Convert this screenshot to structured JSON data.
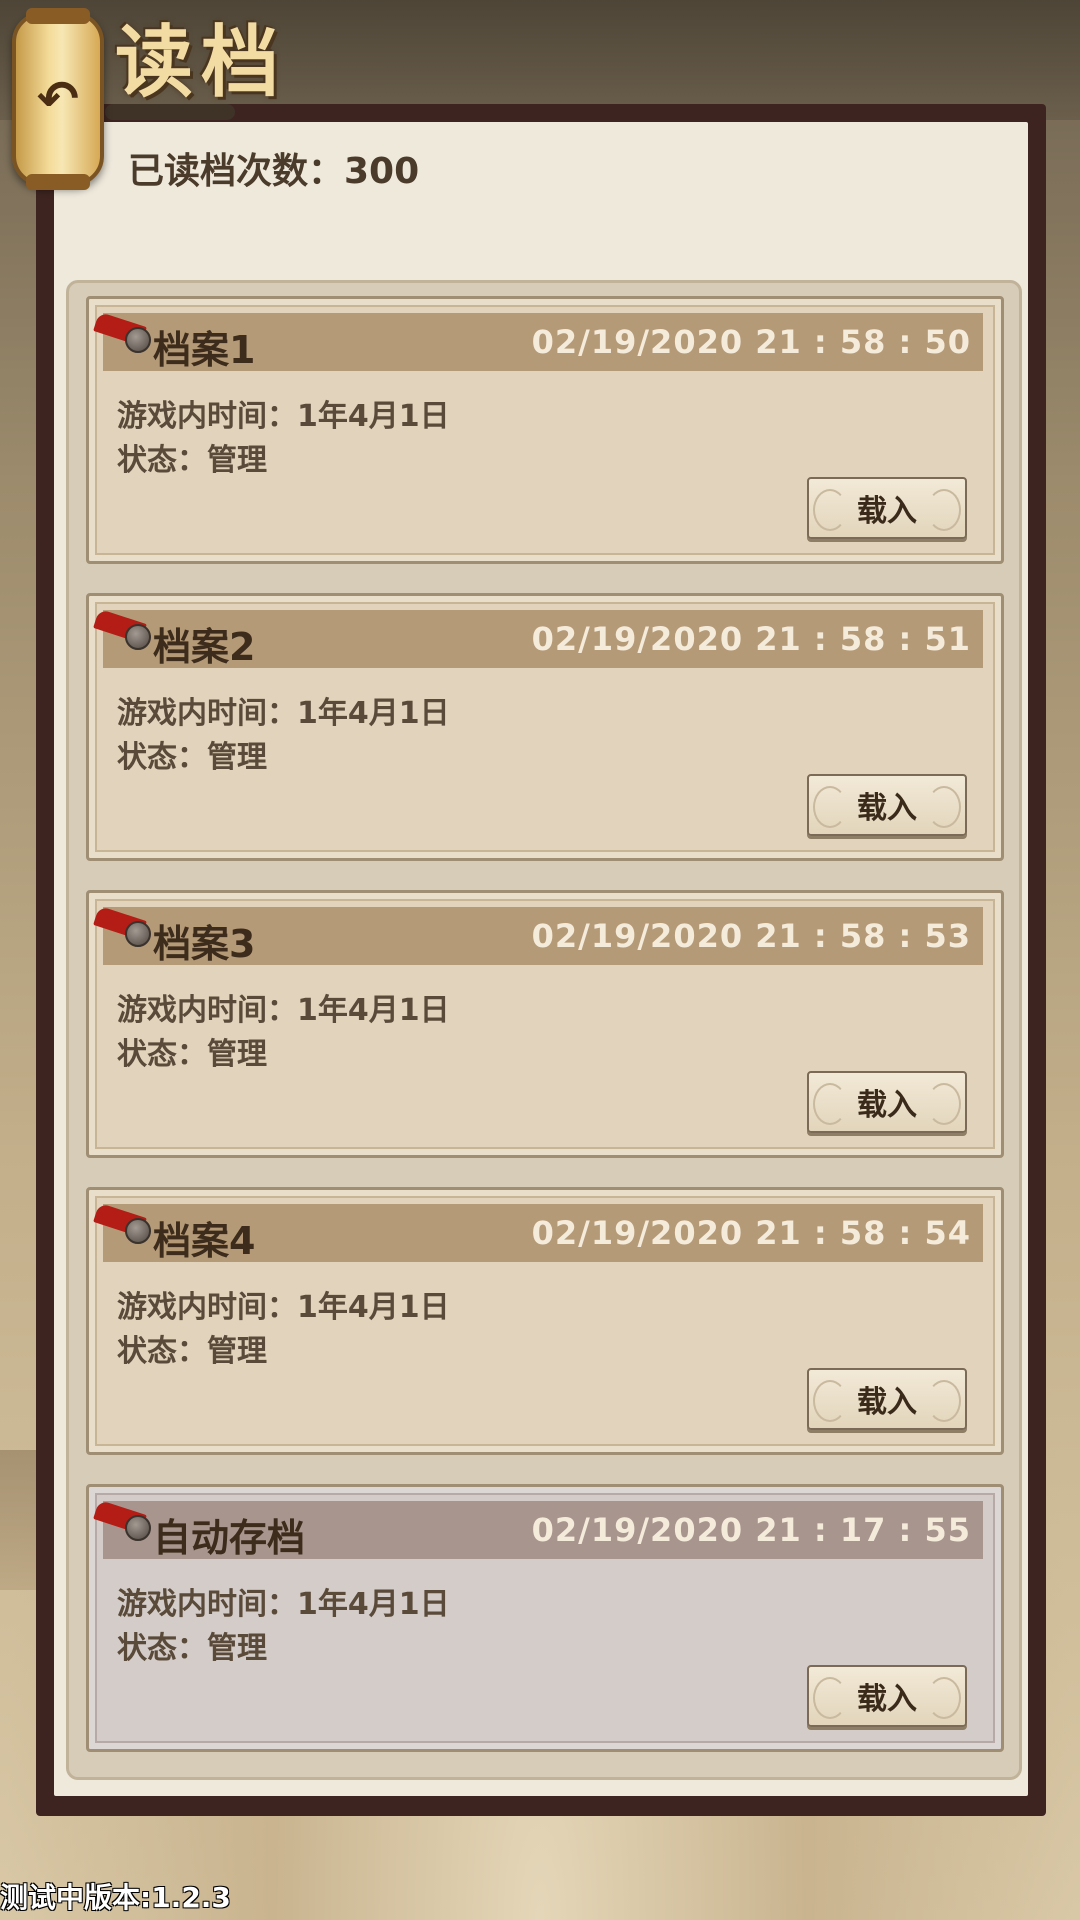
{
  "header": {
    "title": "读档",
    "back_icon": "undo-arrow-icon"
  },
  "summary": {
    "read_count_label": "已读档次数：300"
  },
  "saves": [
    {
      "name": "档案1",
      "datetime": "02/19/2020  21 : 58 : 50",
      "game_time": "游戏内时间：1年4月1日",
      "status": "状态：管理",
      "load_label": "载入"
    },
    {
      "name": "档案2",
      "datetime": "02/19/2020  21 : 58 : 51",
      "game_time": "游戏内时间：1年4月1日",
      "status": "状态：管理",
      "load_label": "载入"
    },
    {
      "name": "档案3",
      "datetime": "02/19/2020  21 : 58 : 53",
      "game_time": "游戏内时间：1年4月1日",
      "status": "状态：管理",
      "load_label": "载入"
    },
    {
      "name": "档案4",
      "datetime": "02/19/2020  21 : 58 : 54",
      "game_time": "游戏内时间：1年4月1日",
      "status": "状态：管理",
      "load_label": "载入"
    },
    {
      "name": "自动存档",
      "datetime": "02/19/2020  21 : 17 : 55",
      "game_time": "游戏内时间：1年4月1日",
      "status": "状态：管理",
      "load_label": "载入"
    }
  ],
  "footer": {
    "version": "测试中版本:1.2.3"
  }
}
